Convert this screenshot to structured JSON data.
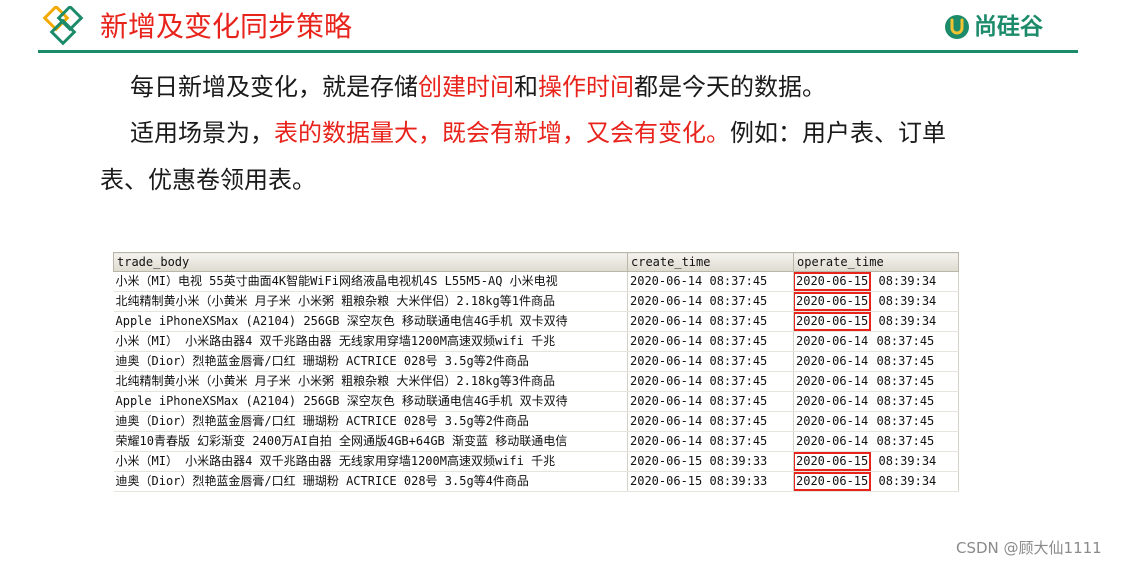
{
  "header": {
    "title": "新增及变化同步策略",
    "brand_name": "尚硅谷",
    "accent_color": "#1c8b6a",
    "title_color": "#e8231b"
  },
  "paragraphs": {
    "p1": {
      "prefix": "每日新增及变化，就是存储",
      "red1": "创建时间",
      "mid": "和",
      "red2": "操作时间",
      "suffix": "都是今天的数据。"
    },
    "p2": {
      "prefix": "适用场景为，",
      "red": "表的数据量大，既会有新增，又会有变化。",
      "suffix_line1": "例如：用户表、订单",
      "line2": "表、优惠卷领用表。"
    }
  },
  "table": {
    "columns": [
      "trade_body",
      "create_time",
      "operate_time"
    ],
    "rows": [
      {
        "trade_body": "小米（MI）电视 55英寸曲面4K智能WiFi网络液晶电视机4S L55M5-AQ 小米电视",
        "create_time": "2020-06-14 08:37:45",
        "operate_date": "2020-06-15",
        "operate_clock": "08:39:34",
        "highlight": true
      },
      {
        "trade_body": "北纯精制黄小米（小黄米 月子米 小米粥 粗粮杂粮 大米伴侣）2.18kg等1件商品",
        "create_time": "2020-06-14 08:37:45",
        "operate_date": "2020-06-15",
        "operate_clock": "08:39:34",
        "highlight": true
      },
      {
        "trade_body": "Apple iPhoneXSMax (A2104) 256GB 深空灰色 移动联通电信4G手机 双卡双待",
        "create_time": "2020-06-14 08:37:45",
        "operate_date": "2020-06-15",
        "operate_clock": "08:39:34",
        "highlight": true
      },
      {
        "trade_body": "小米（MI） 小米路由器4 双千兆路由器 无线家用穿墙1200M高速双频wifi 千兆",
        "create_time": "2020-06-14 08:37:45",
        "operate_date": "2020-06-14",
        "operate_clock": "08:37:45",
        "highlight": false
      },
      {
        "trade_body": "迪奥（Dior）烈艳蓝金唇膏/口红 珊瑚粉 ACTRICE 028号 3.5g等2件商品",
        "create_time": "2020-06-14 08:37:45",
        "operate_date": "2020-06-14",
        "operate_clock": "08:37:45",
        "highlight": false
      },
      {
        "trade_body": "北纯精制黄小米（小黄米 月子米 小米粥 粗粮杂粮 大米伴侣）2.18kg等3件商品",
        "create_time": "2020-06-14 08:37:45",
        "operate_date": "2020-06-14",
        "operate_clock": "08:37:45",
        "highlight": false
      },
      {
        "trade_body": "Apple iPhoneXSMax (A2104) 256GB 深空灰色 移动联通电信4G手机 双卡双待",
        "create_time": "2020-06-14 08:37:45",
        "operate_date": "2020-06-14",
        "operate_clock": "08:37:45",
        "highlight": false
      },
      {
        "trade_body": "迪奥（Dior）烈艳蓝金唇膏/口红 珊瑚粉 ACTRICE 028号 3.5g等2件商品",
        "create_time": "2020-06-14 08:37:45",
        "operate_date": "2020-06-14",
        "operate_clock": "08:37:45",
        "highlight": false
      },
      {
        "trade_body": "荣耀10青春版 幻彩渐变 2400万AI自拍 全网通版4GB+64GB 渐变蓝 移动联通电信",
        "create_time": "2020-06-14 08:37:45",
        "operate_date": "2020-06-14",
        "operate_clock": "08:37:45",
        "highlight": false
      },
      {
        "trade_body": "小米（MI） 小米路由器4 双千兆路由器 无线家用穿墙1200M高速双频wifi 千兆",
        "create_time": "2020-06-15 08:39:33",
        "operate_date": "2020-06-15",
        "operate_clock": "08:39:34",
        "highlight": true
      },
      {
        "trade_body": "迪奥（Dior）烈艳蓝金唇膏/口红 珊瑚粉 ACTRICE 028号 3.5g等4件商品",
        "create_time": "2020-06-15 08:39:33",
        "operate_date": "2020-06-15",
        "operate_clock": "08:39:34",
        "highlight": true
      }
    ]
  },
  "watermark": "CSDN @顾大仙1111"
}
